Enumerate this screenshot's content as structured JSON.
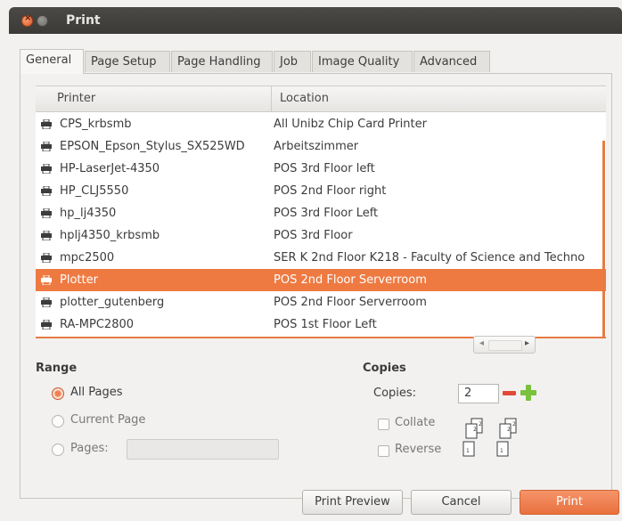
{
  "window": {
    "title": "Print"
  },
  "tabs": [
    {
      "label": "General"
    },
    {
      "label": "Page Setup"
    },
    {
      "label": "Page Handling"
    },
    {
      "label": "Job"
    },
    {
      "label": "Image Quality"
    },
    {
      "label": "Advanced"
    }
  ],
  "printer_list": {
    "headers": {
      "printer": "Printer",
      "location": "Location"
    },
    "rows": [
      {
        "name": "CPS_krbsmb",
        "location": "All Unibz Chip Card Printer"
      },
      {
        "name": "EPSON_Epson_Stylus_SX525WD",
        "location": "Arbeitszimmer"
      },
      {
        "name": "HP-LaserJet-4350",
        "location": "POS 3rd Floor left"
      },
      {
        "name": "HP_CLJ5550",
        "location": "POS 2nd Floor right"
      },
      {
        "name": "hp_lj4350",
        "location": "POS 3rd Floor Left"
      },
      {
        "name": "hplj4350_krbsmb",
        "location": "POS 3rd Floor"
      },
      {
        "name": "mpc2500",
        "location": "SER K 2nd Floor K218 - Faculty of Science and Techno"
      },
      {
        "name": "Plotter",
        "location": "POS 2nd Floor Serverroom",
        "selected": true
      },
      {
        "name": "plotter_gutenberg",
        "location": "POS 2nd Floor Serverroom"
      },
      {
        "name": "RA-MPC2800",
        "location": "POS 1st Floor Left"
      }
    ],
    "selected_color": "#ee7a42"
  },
  "range": {
    "title": "Range",
    "all_pages": "All Pages",
    "current_page": "Current Page",
    "pages": "Pages:",
    "pages_value": ""
  },
  "copies": {
    "title": "Copies",
    "label": "Copies:",
    "value": "2",
    "collate": "Collate",
    "reverse": "Reverse"
  },
  "buttons": {
    "print_preview": "Print Preview",
    "cancel": "Cancel",
    "print": "Print"
  },
  "colors": {
    "accent": "#ee7a42",
    "titlebar": "#3c3b37"
  }
}
